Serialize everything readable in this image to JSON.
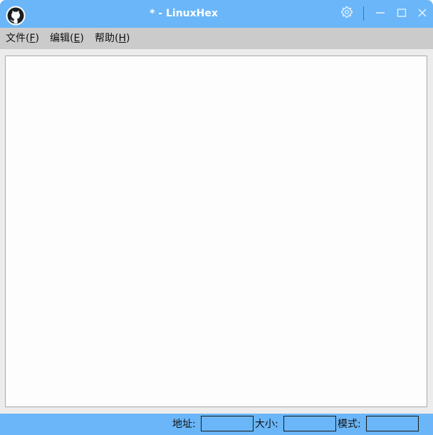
{
  "window": {
    "title": "* - LinuxHex"
  },
  "titlebar": {
    "logo_icon": "github-octocat-icon",
    "settings_icon": "gear-icon",
    "minimize_icon": "minimize-icon",
    "maximize_icon": "maximize-icon",
    "close_icon": "close-icon"
  },
  "menu": {
    "file": {
      "label": "文件(",
      "accel": "F",
      "tail": ")"
    },
    "edit": {
      "label": "编辑(",
      "accel": "E",
      "tail": ")"
    },
    "help": {
      "label": "帮助(",
      "accel": "H",
      "tail": ")"
    }
  },
  "editor": {
    "content": ""
  },
  "status": {
    "address_label": "地址:",
    "address_value": "",
    "size_label": "大小:",
    "size_value": "",
    "mode_label": "模式:",
    "mode_value": ""
  },
  "colors": {
    "titlebar": "#6ab6f8",
    "menubar": "#cbcbcb",
    "statusbar": "#6ab6f8",
    "separator": "#d04040"
  }
}
